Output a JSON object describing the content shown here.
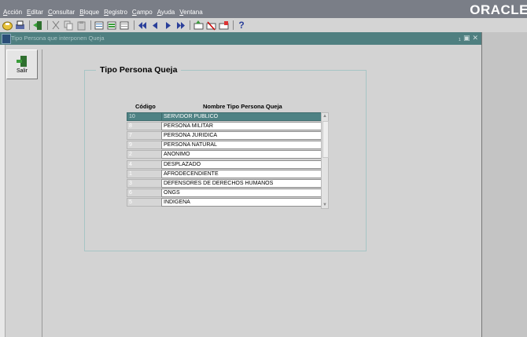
{
  "menu": {
    "items": [
      {
        "mnemonic": "A",
        "rest": "cción"
      },
      {
        "mnemonic": "E",
        "rest": "ditar"
      },
      {
        "mnemonic": "C",
        "rest": "onsultar"
      },
      {
        "mnemonic": "B",
        "rest": "loque"
      },
      {
        "mnemonic": "R",
        "rest": "egistro"
      },
      {
        "mnemonic": "C",
        "rest": "ampo"
      },
      {
        "mnemonic": "A",
        "rest": "yuda"
      },
      {
        "mnemonic": "V",
        "rest": "entana"
      }
    ],
    "brand": "ORACLE"
  },
  "toolbar": {
    "icons": [
      "save-icon",
      "print-icon",
      "exit-icon",
      "cut-icon",
      "copy-icon",
      "paste-icon",
      "enter-query-icon",
      "execute-query-icon",
      "cancel-query-icon",
      "first-record-icon",
      "previous-record-icon",
      "next-record-icon",
      "last-record-icon",
      "insert-record-icon",
      "delete-record-icon",
      "lock-record-icon",
      "help-icon"
    ],
    "help_glyph": "?"
  },
  "window": {
    "title": "Tipo Persona que interponen Queja",
    "controls": [
      "minimize",
      "restore",
      "close"
    ]
  },
  "salir": {
    "label": "Salir"
  },
  "frame": {
    "title": "Tipo Persona Queja"
  },
  "table": {
    "headers": {
      "code": "Código",
      "name": "Nombre Tipo Persona Queja"
    },
    "selected_index": 0,
    "rows": [
      {
        "code": "10",
        "name": "SERVIDOR PUBLICO"
      },
      {
        "code": "8",
        "name": "PERSONA MILITAR"
      },
      {
        "code": "7",
        "name": "PERSONA JURIDICA"
      },
      {
        "code": "9",
        "name": "PERSONA NATURAL"
      },
      {
        "code": "2",
        "name": "ANONIMO"
      },
      {
        "code": "4",
        "name": "DESPLAZADO"
      },
      {
        "code": "1",
        "name": "AFRODECENDIENTE"
      },
      {
        "code": "3",
        "name": "DEFENSORES DE DERECHOS HUMANOS"
      },
      {
        "code": "6",
        "name": "ONGS"
      },
      {
        "code": "5",
        "name": "INDIGENA"
      }
    ]
  }
}
